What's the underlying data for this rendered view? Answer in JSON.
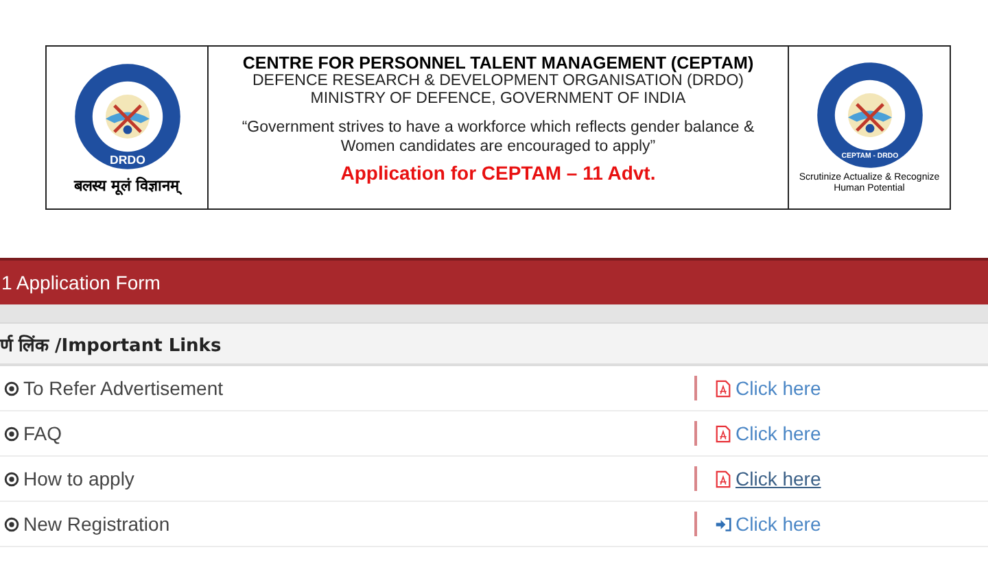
{
  "header": {
    "left_logo": {
      "ring_text": "DRDO",
      "caption": "बलस्य मूलं विज्ञानम्"
    },
    "title": "CENTRE FOR PERSONNEL TALENT MANAGEMENT (CEPTAM)",
    "subtitle_lines": [
      "DEFENCE RESEARCH & DEVELOPMENT ORGANISATION (DRDO)",
      "MINISTRY OF DEFENCE, GOVERNMENT OF INDIA"
    ],
    "quote_lines": [
      "“Government strives to have a workforce which reflects gender balance &",
      "Women candidates are encouraged to apply”"
    ],
    "application_title": "Application for CEPTAM – 11 Advt.",
    "right_logo": {
      "ring_text": "CEPTAM - DRDO",
      "caption_lines": [
        "Scrutinize Actualize & Recognize",
        "Human Potential"
      ]
    }
  },
  "form_bar": {
    "title": "1 Application Form"
  },
  "links_panel": {
    "heading": "र्ण लिंक /Important Links",
    "rows": [
      {
        "label": "To Refer Advertisement",
        "link": "Click here",
        "kind": "pdf",
        "underlined": false
      },
      {
        "label": "FAQ",
        "link": "Click here",
        "kind": "pdf",
        "underlined": false
      },
      {
        "label": "How to apply",
        "link": "Click here",
        "kind": "pdf",
        "underlined": true
      },
      {
        "label": "New Registration",
        "link": "Click here",
        "kind": "login",
        "underlined": false
      }
    ]
  }
}
